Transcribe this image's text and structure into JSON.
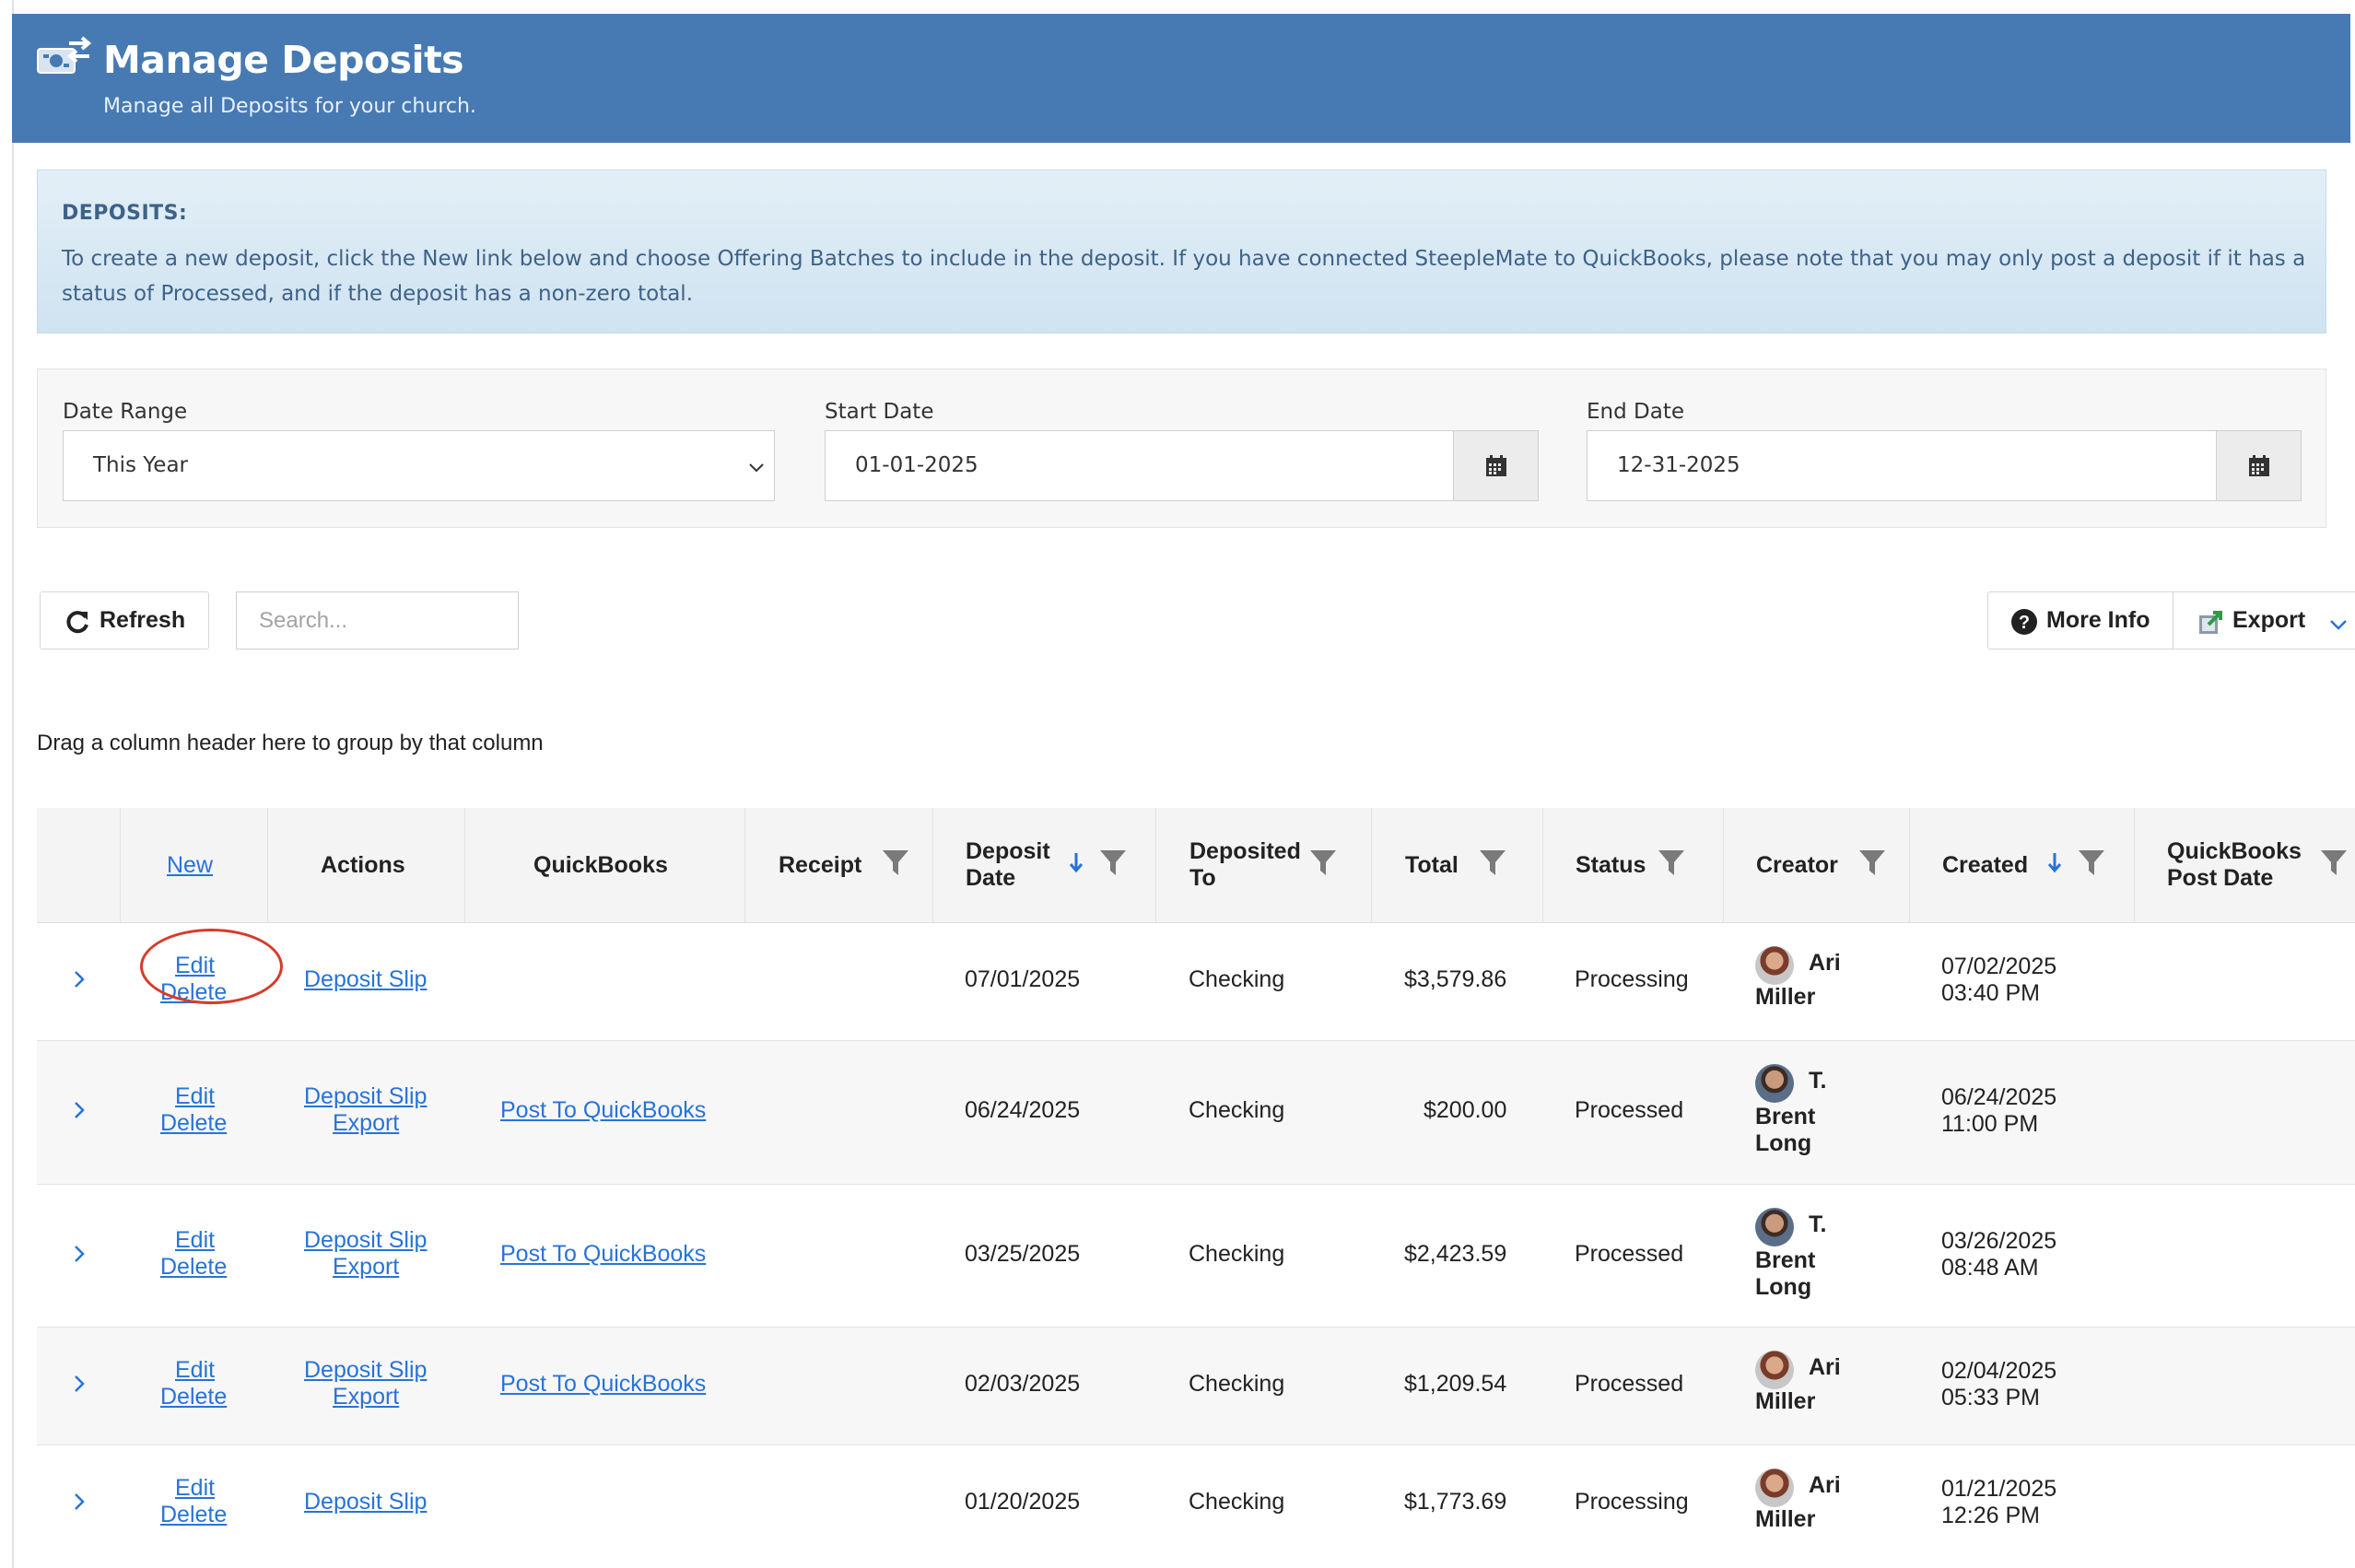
{
  "header": {
    "title": "Manage Deposits",
    "subtitle": "Manage all Deposits for your church."
  },
  "info": {
    "title": "DEPOSITS:",
    "text": "To create a new deposit, click the New link below and choose Offering Batches to include in the deposit. If you have connected SteepleMate to QuickBooks, please note that you may only post a deposit if it has a status of Processed, and if the deposit has a non-zero total."
  },
  "filters": {
    "date_range_label": "Date Range",
    "date_range_value": "This Year",
    "start_label": "Start Date",
    "start_value": "01-01-2025",
    "end_label": "End Date",
    "end_value": "12-31-2025"
  },
  "toolbar": {
    "refresh_label": "Refresh",
    "search_placeholder": "Search...",
    "more_info_label": "More Info",
    "export_label": "Export"
  },
  "group_hint": "Drag a column header here to group by that column",
  "grid": {
    "headers": {
      "new": "New",
      "actions": "Actions",
      "quickbooks": "QuickBooks",
      "receipt": "Receipt",
      "deposit_date_1": "Deposit",
      "deposit_date_2": "Date",
      "deposited_to_1": "Deposited",
      "deposited_to_2": "To",
      "total": "Total",
      "status": "Status",
      "creator": "Creator",
      "created": "Created",
      "qb_post_1": "QuickBooks",
      "qb_post_2": "Post Date"
    },
    "rows": [
      {
        "edit": "Edit",
        "delete": "Delete",
        "slip": "Deposit Slip",
        "export": "",
        "post": "",
        "date": "07/01/2025",
        "to": "Checking",
        "total": "$3,579.86",
        "status": "Processing",
        "creator_1": "Ari",
        "creator_2": "Miller",
        "creator_3": "",
        "created_date": "07/02/2025",
        "created_time": "03:40 PM"
      },
      {
        "edit": "Edit",
        "delete": "Delete",
        "slip": "Deposit Slip",
        "export": "Export",
        "post": "Post To QuickBooks",
        "date": "06/24/2025",
        "to": "Checking",
        "total": "$200.00",
        "status": "Processed",
        "creator_1": "T.",
        "creator_2": "Brent",
        "creator_3": "Long",
        "created_date": "06/24/2025",
        "created_time": "11:00 PM"
      },
      {
        "edit": "Edit",
        "delete": "Delete",
        "slip": "Deposit Slip",
        "export": "Export",
        "post": "Post To QuickBooks",
        "date": "03/25/2025",
        "to": "Checking",
        "total": "$2,423.59",
        "status": "Processed",
        "creator_1": "T.",
        "creator_2": "Brent",
        "creator_3": "Long",
        "created_date": "03/26/2025",
        "created_time": "08:48 AM"
      },
      {
        "edit": "Edit",
        "delete": "Delete",
        "slip": "Deposit Slip",
        "export": "Export",
        "post": "Post To QuickBooks",
        "date": "02/03/2025",
        "to": "Checking",
        "total": "$1,209.54",
        "status": "Processed",
        "creator_1": "Ari",
        "creator_2": "Miller",
        "creator_3": "",
        "created_date": "02/04/2025",
        "created_time": "05:33 PM"
      },
      {
        "edit": "Edit",
        "delete": "Delete",
        "slip": "Deposit Slip",
        "export": "",
        "post": "",
        "date": "01/20/2025",
        "to": "Checking",
        "total": "$1,773.69",
        "status": "Processing",
        "creator_1": "Ari",
        "creator_2": "Miller",
        "creator_3": "",
        "created_date": "01/21/2025",
        "created_time": "12:26 PM"
      }
    ]
  },
  "colors": {
    "header_bg": "#477ab3",
    "link": "#2873d8",
    "highlight": "#d93a2b",
    "info_text": "#3e6287"
  }
}
